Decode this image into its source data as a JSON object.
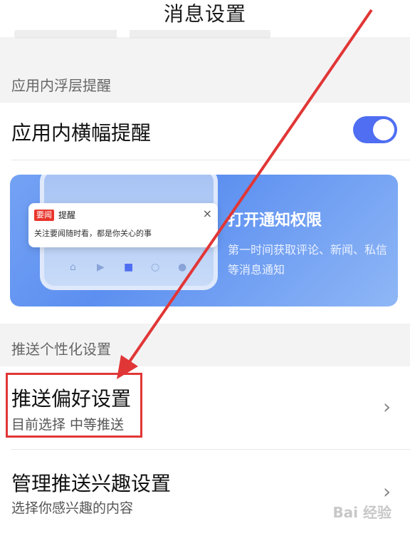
{
  "header": {
    "title": "消息设置"
  },
  "floating_section": {
    "title": "应用内浮层提醒"
  },
  "banner_reminder": {
    "label": "应用内横幅提醒",
    "enabled": true,
    "accent_color": "#4f6ef2"
  },
  "banner": {
    "notification": {
      "logo": "要闻",
      "title": "提醒",
      "body": "关注要闻随时看，都是你关心的事",
      "close": "×"
    },
    "title": "打开通知权限",
    "subtitle": "第一时间获取评论、新闻、私信等消息通知"
  },
  "personalization_section": {
    "title": "推送个性化设置"
  },
  "push_preference": {
    "title": "推送偏好设置",
    "subtitle": "目前选择 中等推送"
  },
  "manage_interest": {
    "title": "管理推送兴趣设置",
    "subtitle": "选择你感兴趣的内容"
  },
  "watermark": "Bai 经验",
  "annotation_color": "#e13636"
}
